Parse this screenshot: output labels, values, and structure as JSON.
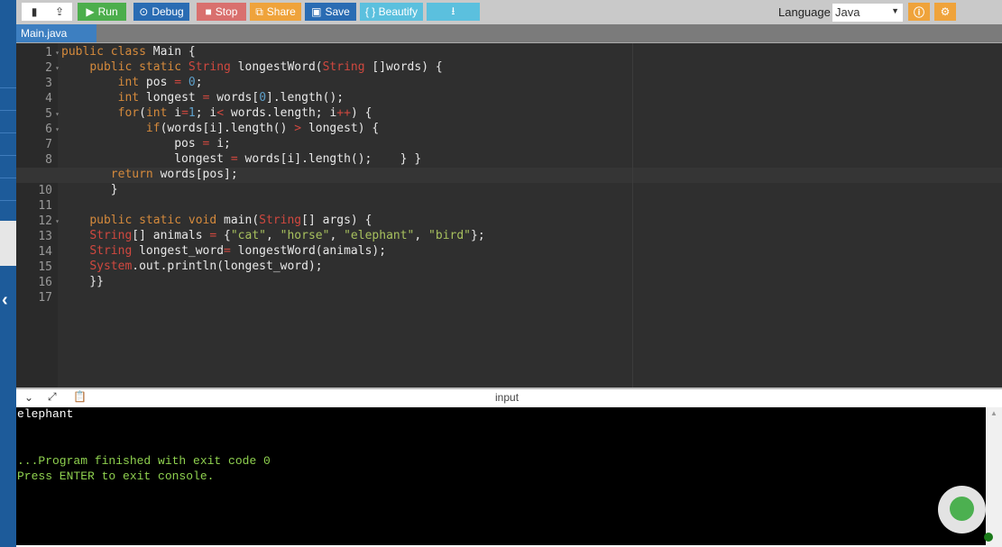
{
  "toolbar": {
    "new_file": "new-file-icon",
    "upload": "upload-icon",
    "run": "Run",
    "debug": "Debug",
    "stop": "Stop",
    "share": "Share",
    "save": "Save",
    "beautify": "{ } Beautify",
    "download": "download-icon",
    "language_label": "Language",
    "language_value": "Java"
  },
  "colors": {
    "run": "#4cae4c",
    "debug": "#2a6cb3",
    "stop": "#d9706e",
    "share": "#efa33b",
    "save": "#2a6cb3",
    "beautify": "#5bc0de",
    "download": "#5bc0de",
    "info": "#efa33b",
    "settings": "#efa33b"
  },
  "tab": {
    "label": "Main.java"
  },
  "editor": {
    "lines": [
      [
        [
          "kw",
          "public class "
        ],
        [
          "pl",
          "Main {"
        ]
      ],
      [
        [
          "pl",
          "    "
        ],
        [
          "kw",
          "public static "
        ],
        [
          "ty",
          "String"
        ],
        [
          "pl",
          " longestWord("
        ],
        [
          "ty",
          "String"
        ],
        [
          "pl",
          " []words) {"
        ]
      ],
      [
        [
          "pl",
          "        "
        ],
        [
          "kw",
          "int"
        ],
        [
          "pl",
          " pos "
        ],
        [
          "op",
          "="
        ],
        [
          "pl",
          " "
        ],
        [
          "num",
          "0"
        ],
        [
          "pl",
          ";"
        ]
      ],
      [
        [
          "pl",
          "        "
        ],
        [
          "kw",
          "int"
        ],
        [
          "pl",
          " longest "
        ],
        [
          "op",
          "="
        ],
        [
          "pl",
          " words["
        ],
        [
          "num",
          "0"
        ],
        [
          "pl",
          "].length();"
        ]
      ],
      [
        [
          "pl",
          "        "
        ],
        [
          "kw",
          "for"
        ],
        [
          "pl",
          "("
        ],
        [
          "kw",
          "int"
        ],
        [
          "pl",
          " i"
        ],
        [
          "op",
          "="
        ],
        [
          "num",
          "1"
        ],
        [
          "pl",
          "; i"
        ],
        [
          "op",
          "<"
        ],
        [
          "pl",
          " words.length; i"
        ],
        [
          "op",
          "++"
        ],
        [
          "pl",
          ") {"
        ]
      ],
      [
        [
          "pl",
          "            "
        ],
        [
          "kw",
          "if"
        ],
        [
          "pl",
          "(words[i].length() "
        ],
        [
          "op",
          ">"
        ],
        [
          "pl",
          " longest) {"
        ]
      ],
      [
        [
          "pl",
          "                pos "
        ],
        [
          "op",
          "="
        ],
        [
          "pl",
          " i;"
        ]
      ],
      [
        [
          "pl",
          "                longest "
        ],
        [
          "op",
          "="
        ],
        [
          "pl",
          " words[i].length();    } }"
        ]
      ],
      [
        [
          "pl",
          "       "
        ],
        [
          "kw",
          "return"
        ],
        [
          "pl",
          " words[pos];"
        ]
      ],
      [
        [
          "pl",
          "       }"
        ]
      ],
      [
        [
          "pl",
          ""
        ]
      ],
      [
        [
          "pl",
          "    "
        ],
        [
          "kw",
          "public static void"
        ],
        [
          "pl",
          " main("
        ],
        [
          "ty",
          "String"
        ],
        [
          "pl",
          "[] args) {"
        ]
      ],
      [
        [
          "pl",
          "    "
        ],
        [
          "ty",
          "String"
        ],
        [
          "pl",
          "[] animals "
        ],
        [
          "op",
          "="
        ],
        [
          "pl",
          " {"
        ],
        [
          "str",
          "\"cat\""
        ],
        [
          "pl",
          ", "
        ],
        [
          "str",
          "\"horse\""
        ],
        [
          "pl",
          ", "
        ],
        [
          "str",
          "\"elephant\""
        ],
        [
          "pl",
          ", "
        ],
        [
          "str",
          "\"bird\""
        ],
        [
          "pl",
          "};"
        ]
      ],
      [
        [
          "pl",
          "    "
        ],
        [
          "ty",
          "String"
        ],
        [
          "pl",
          " longest_word"
        ],
        [
          "op",
          "="
        ],
        [
          "pl",
          " longestWord(animals);"
        ]
      ],
      [
        [
          "pl",
          "    "
        ],
        [
          "ty",
          "System"
        ],
        [
          "pl",
          ".out.println(longest_word);"
        ]
      ],
      [
        [
          "pl",
          "    }}"
        ]
      ],
      [
        [
          "pl",
          ""
        ]
      ]
    ],
    "fold_lines": [
      1,
      2,
      5,
      6,
      12
    ],
    "active_line": 9
  },
  "console": {
    "input_label": "input",
    "output": "elephant",
    "finished": "...Program finished with exit code 0",
    "press_enter": "Press ENTER to exit console."
  }
}
